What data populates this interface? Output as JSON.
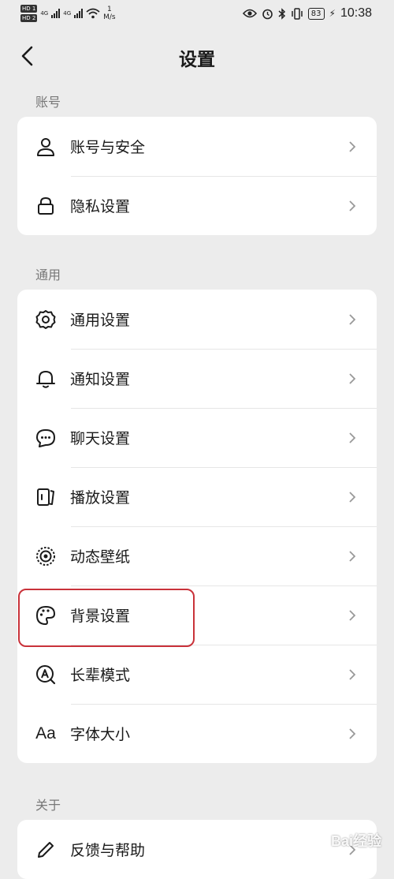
{
  "status_bar": {
    "hd1": "HD 1",
    "hd2": "HD 2",
    "net1": "4G",
    "net2": "4G",
    "speed_value": "1",
    "speed_unit": "M/s",
    "battery": "83",
    "time": "10:38"
  },
  "header": {
    "title": "设置"
  },
  "sections": {
    "account": {
      "label": "账号",
      "items": [
        {
          "label": "账号与安全",
          "icon": "person-icon"
        },
        {
          "label": "隐私设置",
          "icon": "lock-icon"
        }
      ]
    },
    "general": {
      "label": "通用",
      "items": [
        {
          "label": "通用设置",
          "icon": "gear-icon"
        },
        {
          "label": "通知设置",
          "icon": "bell-icon"
        },
        {
          "label": "聊天设置",
          "icon": "chat-bubble-icon"
        },
        {
          "label": "播放设置",
          "icon": "play-card-icon"
        },
        {
          "label": "动态壁纸",
          "icon": "live-wallpaper-icon"
        },
        {
          "label": "背景设置",
          "icon": "palette-icon"
        },
        {
          "label": "长辈模式",
          "icon": "elder-mode-icon"
        },
        {
          "label": "字体大小",
          "icon": "font-size-icon",
          "icon_text": "Aa"
        }
      ]
    },
    "about": {
      "label": "关于",
      "items": [
        {
          "label": "反馈与帮助",
          "icon": "pencil-icon"
        }
      ]
    }
  },
  "highlight_color": "#c9323a",
  "watermark": "Bai经验"
}
